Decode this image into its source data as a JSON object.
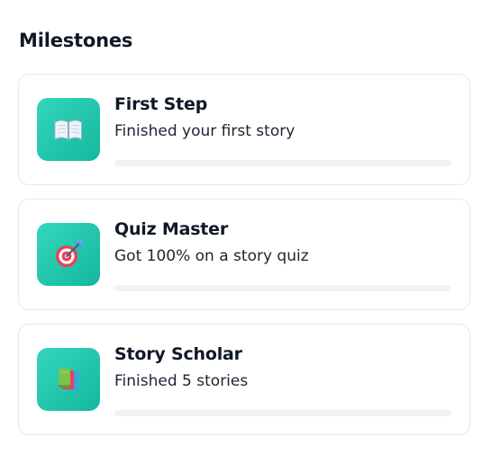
{
  "section": {
    "title": "Milestones"
  },
  "milestones": [
    {
      "title": "First Step",
      "description": "Finished your first story",
      "icon": "open-book-icon",
      "progress": 0
    },
    {
      "title": "Quiz Master",
      "description": "Got 100% on a story quiz",
      "icon": "target-icon",
      "progress": 0
    },
    {
      "title": "Story Scholar",
      "description": "Finished 5 stories",
      "icon": "books-icon",
      "progress": 0
    }
  ],
  "colors": {
    "icon_tile_start": "#34d6bd",
    "icon_tile_end": "#14b89c",
    "progress_track": "#f1f2f4",
    "card_border": "#e6e8ec",
    "text_primary": "#101828"
  }
}
